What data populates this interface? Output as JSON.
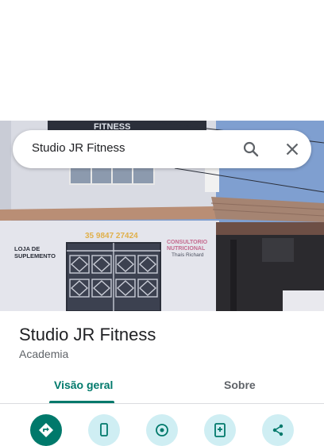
{
  "search": {
    "value": "Studio JR Fitness"
  },
  "photo": {
    "sign_top": "FITNESS",
    "phone": "35 9847 27424",
    "shop_sign": "LOJA DE SUPLEMENTO",
    "clinic_sign_line1": "CONSULTORIO",
    "clinic_sign_line2": "NUTRICIONAL",
    "clinic_sign_name": "Thaís Richard"
  },
  "place": {
    "title": "Studio JR Fitness",
    "category": "Academia"
  },
  "tabs": [
    {
      "label": "Visão geral",
      "selected": true
    },
    {
      "label": "Sobre",
      "selected": false
    }
  ],
  "actions": [
    {
      "icon": "directions-icon"
    },
    {
      "icon": "phone-icon"
    },
    {
      "icon": "nearby-icon"
    },
    {
      "icon": "save-icon"
    },
    {
      "icon": "share-icon"
    }
  ],
  "colors": {
    "accent": "#00796b",
    "action_bg": "#cfeef3"
  }
}
